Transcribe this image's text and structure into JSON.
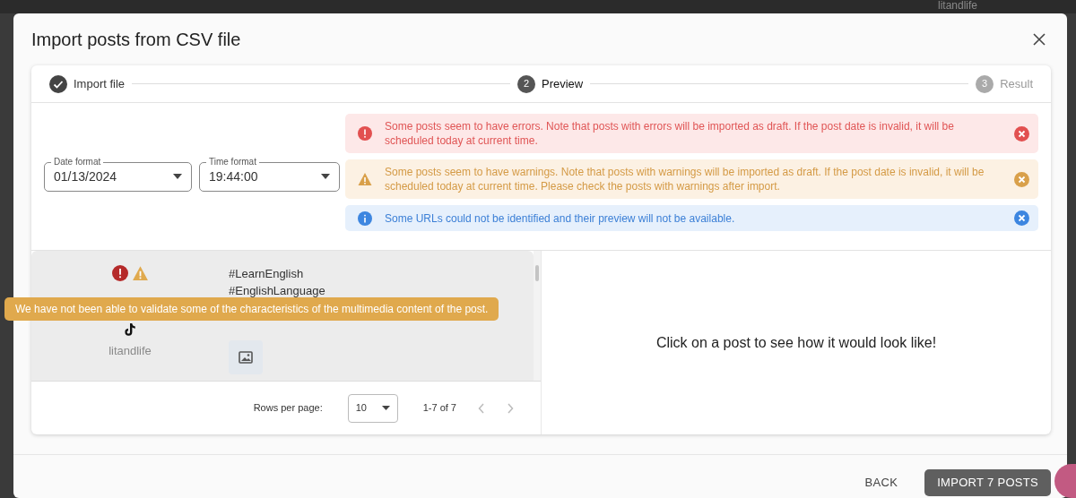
{
  "background": {
    "username": "litandlife"
  },
  "modal": {
    "title": "Import posts from CSV file"
  },
  "steps": [
    {
      "label": "Import file",
      "completed": true,
      "selected": false
    },
    {
      "label": "Preview",
      "number": "2",
      "completed": false,
      "selected": true
    },
    {
      "label": "Result",
      "number": "3",
      "completed": false,
      "selected": false
    }
  ],
  "formats": [
    {
      "label": "Date format",
      "value": "01/13/2024"
    },
    {
      "label": "Time format",
      "value": "19:44:00"
    }
  ],
  "alerts": [
    {
      "kind": "error",
      "text": "Some posts seem to have errors. Note that posts with errors will be imported as draft. If the post date is invalid, it will be scheduled today at current time."
    },
    {
      "kind": "warning",
      "text": "Some posts seem to have warnings. Note that posts with warnings will be imported as draft. If the post date is invalid, it will be scheduled today at current time. Please check the posts with warnings after import."
    },
    {
      "kind": "info",
      "text": "Some URLs could not be identified and their preview will not be available."
    }
  ],
  "posts": [
    {
      "has_error": true,
      "has_warning": true,
      "account": "litandlife",
      "hashtags": [
        "#LearnEnglish",
        "#EnglishLanguage"
      ],
      "has_image": true
    }
  ],
  "tooltip": "We have not been able to validate some of the characteristics of the multimedia content of the post.",
  "pagination": {
    "rows_label": "Rows per page:",
    "rows_value": "10",
    "range": "1-7 of 7"
  },
  "preview_hint": "Click on a post to see how it would look like!",
  "buttons": [
    {
      "kind": "text",
      "label": "BACK"
    },
    {
      "kind": "primary",
      "label": "IMPORT 7 POSTS"
    }
  ]
}
